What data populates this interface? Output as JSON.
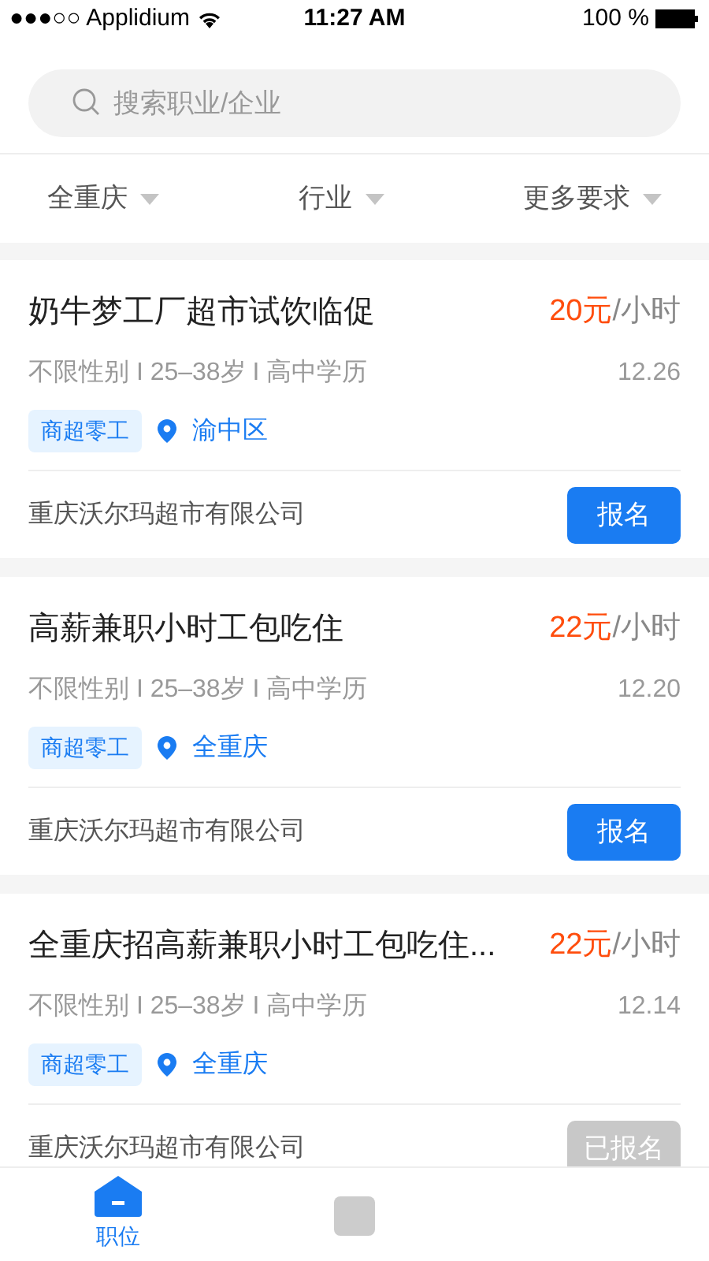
{
  "status_bar": {
    "carrier": "●●●○○ Applidium",
    "time": "11:27 AM",
    "battery": "100 %"
  },
  "search": {
    "placeholder": "搜索职业/企业"
  },
  "filters": [
    {
      "label": "全重庆"
    },
    {
      "label": "行业"
    },
    {
      "label": "更多要求"
    }
  ],
  "jobs": [
    {
      "title": "奶牛梦工厂超市试饮临促",
      "price": "20元",
      "unit": "/小时",
      "meta": "不限性别 I 25–38岁 I 高中学历",
      "date": "12.26",
      "tag": "商超零工",
      "location": "渝中区",
      "company": "重庆沃尔玛超市有限公司",
      "button": {
        "label": "报名",
        "applied": false
      }
    },
    {
      "title": "高薪兼职小时工包吃住",
      "price": "22元",
      "unit": "/小时",
      "meta": "不限性别 I 25–38岁 I 高中学历",
      "date": "12.20",
      "tag": "商超零工",
      "location": "全重庆",
      "company": "重庆沃尔玛超市有限公司",
      "button": {
        "label": "报名",
        "applied": false
      }
    },
    {
      "title": "全重庆招高薪兼职小时工包吃住...",
      "price": "22元",
      "unit": "/小时",
      "meta": "不限性别 I 25–38岁 I 高中学历",
      "date": "12.14",
      "tag": "商超零工",
      "location": "全重庆",
      "company": "重庆沃尔玛超市有限公司",
      "button": {
        "label": "已报名",
        "applied": true
      }
    }
  ],
  "tab_bar": [
    {
      "label": "职位",
      "selected": true
    },
    {
      "selected": false
    }
  ]
}
